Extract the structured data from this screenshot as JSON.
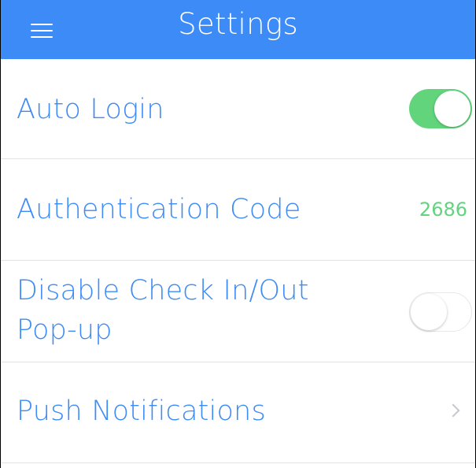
{
  "header": {
    "title": "Settings",
    "menu_icon": "hamburger-menu-icon",
    "background_color": "#3d8bf6"
  },
  "settings": {
    "auto_login": {
      "label": "Auto Login",
      "toggle_state": "on",
      "toggle_color": "#61d47c"
    },
    "authentication_code": {
      "label": "Authentication Code",
      "value": "2686",
      "value_color": "#62d37e"
    },
    "disable_check_popup": {
      "label_line1": "Disable Check In/Out",
      "label_line2": "Pop-up",
      "toggle_state": "off"
    },
    "push_notifications": {
      "label": "Push Notifications",
      "accessory_icon": "chevron-right-icon"
    }
  },
  "colors": {
    "accent": "#3d8bf6",
    "success": "#61d47c",
    "separator": "#e3e3e3"
  }
}
